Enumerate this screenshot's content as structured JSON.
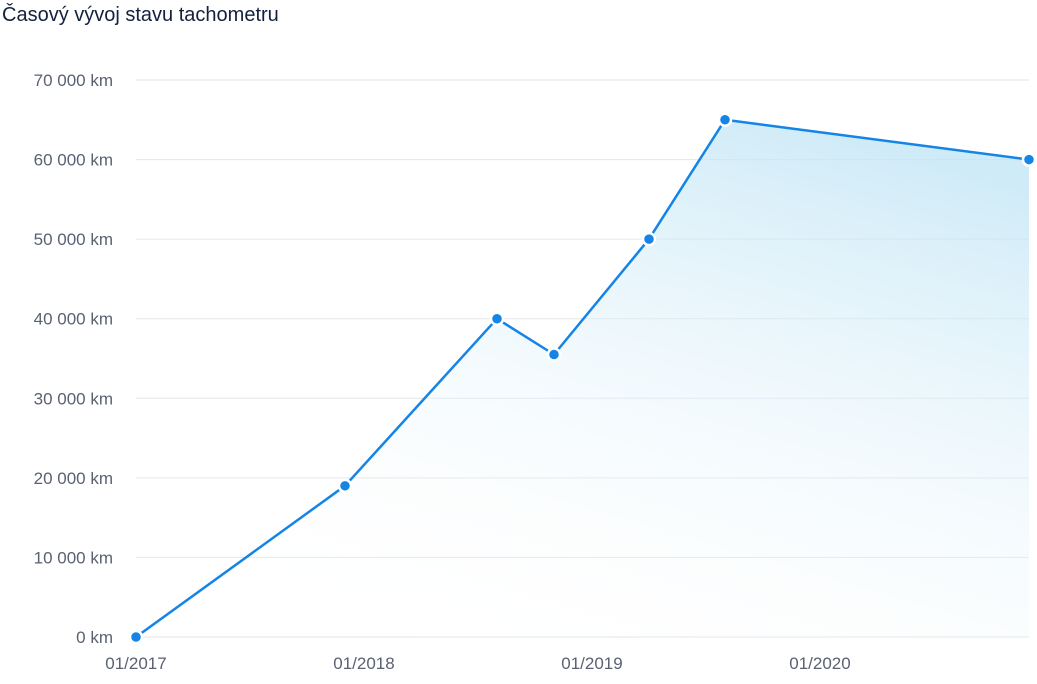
{
  "title": "Časový vývoj stavu tachometru",
  "colors": {
    "line": "#1484e6",
    "area_top": "#bfe4f5",
    "grid": "#e4e6eb",
    "text": "#5a6172",
    "title": "#14213d"
  },
  "chart_data": {
    "type": "area",
    "title": "Časový vývoj stavu tachometru",
    "xlabel": "",
    "ylabel": "",
    "ylim": [
      0,
      70000
    ],
    "xlim": [
      "2017-01",
      "2020-12"
    ],
    "grid": true,
    "y_ticks": [
      {
        "value": 0,
        "label": "0 km"
      },
      {
        "value": 10000,
        "label": "10 000 km"
      },
      {
        "value": 20000,
        "label": "20 000 km"
      },
      {
        "value": 30000,
        "label": "30 000 km"
      },
      {
        "value": 40000,
        "label": "40 000 km"
      },
      {
        "value": 50000,
        "label": "50 000 km"
      },
      {
        "value": 60000,
        "label": "60 000 km"
      },
      {
        "value": 70000,
        "label": "70 000 km"
      }
    ],
    "x_ticks": [
      {
        "value": "2017-01",
        "label": "01/2017"
      },
      {
        "value": "2018-01",
        "label": "01/2018"
      },
      {
        "value": "2019-01",
        "label": "01/2019"
      },
      {
        "value": "2020-01",
        "label": "01/2020"
      }
    ],
    "series": [
      {
        "points": [
          {
            "x": "2017-01",
            "y": 0
          },
          {
            "x": "2017-12",
            "y": 19000
          },
          {
            "x": "2018-08",
            "y": 40000
          },
          {
            "x": "2018-11",
            "y": 35500
          },
          {
            "x": "2019-04",
            "y": 50000
          },
          {
            "x": "2019-08",
            "y": 65000
          },
          {
            "x": "2020-12",
            "y": 60000
          }
        ]
      }
    ]
  }
}
